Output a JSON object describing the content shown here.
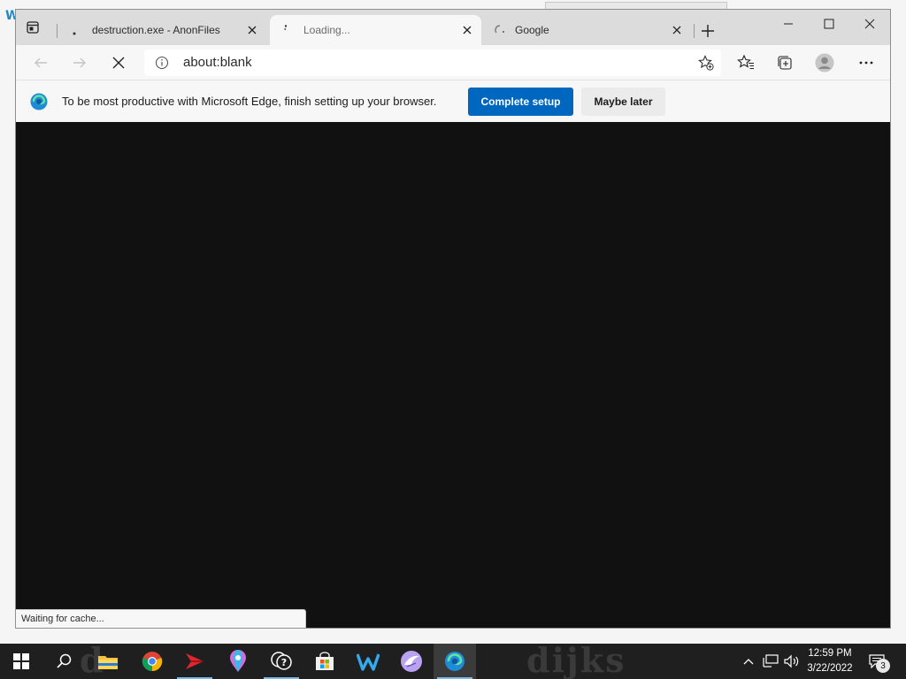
{
  "browser": {
    "tabs": [
      {
        "title": "destruction.exe - AnonFiles",
        "active": false,
        "favicon": "dot-icon"
      },
      {
        "title": "Loading...",
        "active": true,
        "favicon": "loading-spinner-icon"
      },
      {
        "title": "Google",
        "active": false,
        "favicon": "loading-spinner-icon"
      }
    ],
    "new_tab_icon": "plus-icon",
    "window_controls": [
      "minimize-icon",
      "maximize-icon",
      "close-icon"
    ],
    "address_bar": {
      "url": "about:blank",
      "icon": "info-icon"
    },
    "infobar": {
      "message": "To be most productive with Microsoft Edge, finish setting up your browser.",
      "primary_button": "Complete setup",
      "secondary_button": "Maybe later",
      "primary_color": "#0067c0"
    },
    "status_text": "Waiting for cache...",
    "page_background": "#111111"
  },
  "taskbar": {
    "apps": [
      "start-icon",
      "search-icon",
      "file-explorer-icon",
      "chrome-icon",
      "red-app-icon",
      "maps-icon",
      "help-icon",
      "store-icon",
      "w-app-icon",
      "bird-app-icon",
      "edge-icon"
    ],
    "active_app": "edge-icon",
    "clock_time": "12:59 PM",
    "clock_date": "3/22/2022",
    "notification_count": "3"
  }
}
